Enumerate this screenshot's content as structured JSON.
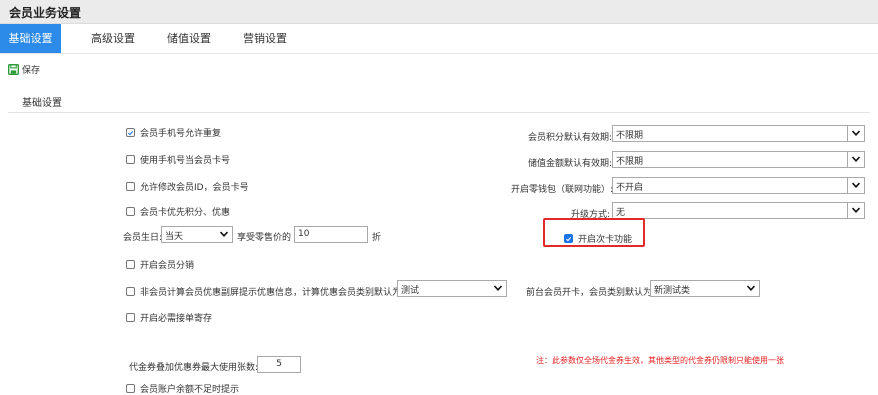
{
  "window": {
    "title": "会员业务设置"
  },
  "tabs": [
    {
      "label": "基础设置",
      "active": true
    },
    {
      "label": "高级设置",
      "active": false
    },
    {
      "label": "储值设置",
      "active": false
    },
    {
      "label": "营销设置",
      "active": false
    }
  ],
  "toolbar": {
    "save_label": "保存",
    "save_icon": "save-icon"
  },
  "section": {
    "title": "基础设置"
  },
  "left_options": {
    "phone_repeat": {
      "label": "会员手机号允许重复",
      "checked": true
    },
    "phone_as_card": {
      "label": "使用手机号当会员卡号",
      "checked": false
    },
    "allow_modify_id": {
      "label": "允许修改会员ID，会员卡号",
      "checked": false
    },
    "card_priority": {
      "label": "会员卡优先积分、优惠",
      "checked": false
    },
    "birthday": {
      "label": "会员生日:",
      "select_value": "当天",
      "discount_label": "享受零售价的",
      "discount_value": "10",
      "discount_unit": "折"
    },
    "member_distribution": {
      "label": "开启会员分销",
      "checked": false
    },
    "non_member_prompt": {
      "label": "非会员计算会员优惠副屏提示优惠信息，计算优惠会员类别默认为",
      "checked": false,
      "select_value": "测试"
    },
    "must_pick_order": {
      "label": "开启必需接单寄存",
      "checked": false
    },
    "coupon_limit": {
      "label": "代金券叠加优惠券最大使用张数:",
      "value": "5"
    },
    "partial_label": "会员账户余额不足时提示"
  },
  "right_options": {
    "points_validity": {
      "label": "会员积分默认有效期:",
      "value": "不限期"
    },
    "stored_value_validity": {
      "label": "储值金额默认有效期:",
      "value": "不限期"
    },
    "retail_wallet": {
      "label": "开启零钱包（联网功能）:",
      "value": "不开启"
    },
    "upgrade_mode": {
      "label": "升级方式:",
      "value": "无"
    },
    "times_card": {
      "label": "开启次卡功能",
      "checked": true
    },
    "front_open_card": {
      "label": "前台会员开卡，会员类别默认为",
      "value": "新测试类"
    }
  },
  "note": "注：此参数仅全场代金券生效，其他类型的代金券仍限制只能使用一张",
  "colors": {
    "tab_active": "#2c8ae8",
    "highlight": "#e12a2a",
    "note": "#e02020"
  }
}
